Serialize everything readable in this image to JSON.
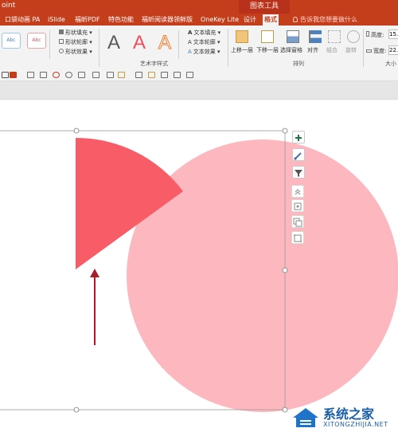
{
  "titlebar": {
    "app_fragment": "oint",
    "context_tab": "图表工具"
  },
  "tabs": [
    {
      "label": "口袋动画 PA",
      "active": false
    },
    {
      "label": "iSlide",
      "active": false
    },
    {
      "label": "福昕PDF",
      "active": false
    },
    {
      "label": "特色功能",
      "active": false
    },
    {
      "label": "福昕阅读器领鲜版",
      "active": false
    },
    {
      "label": "OneKey Lite",
      "active": false
    },
    {
      "label": "设计",
      "active": false
    },
    {
      "label": "格式",
      "active": true
    }
  ],
  "tell_me": "告诉我您想要做什么",
  "ribbon": {
    "shape_styles": {
      "swatch1": "Abc",
      "swatch2": "Abc",
      "fill": "形状填充",
      "outline": "形状轮廓",
      "effects": "形状效果"
    },
    "wordart": {
      "letter": "A",
      "text_fill": "文本填充",
      "text_outline": "文本轮廓",
      "text_effects": "文本效果",
      "group_label": "艺术字样式"
    },
    "arrange": {
      "bring_forward": "上移一层",
      "send_backward": "下移一层",
      "selection_pane": "选择窗格",
      "align": "对齐",
      "group": "组合",
      "rotate": "旋转",
      "group_label": "排列"
    },
    "size": {
      "height_label": "高度:",
      "height_value": "15.",
      "width_label": "宽度:",
      "width_value": "22.",
      "group_label": "大小"
    }
  },
  "colors": {
    "ribbon_red": "#c43e1c",
    "pie_slice": "#f85c67",
    "big_circle": "#fdb8bf",
    "arrow": "#a31e2a",
    "chart_button_plus": "#217346"
  },
  "chart_side_buttons": [
    "chart-elements-plus-icon",
    "chart-styles-brush-icon",
    "chart-filters-funnel-icon"
  ],
  "watermark": {
    "title": "系统之家",
    "url": "XITONGZHIJIA.NET"
  }
}
